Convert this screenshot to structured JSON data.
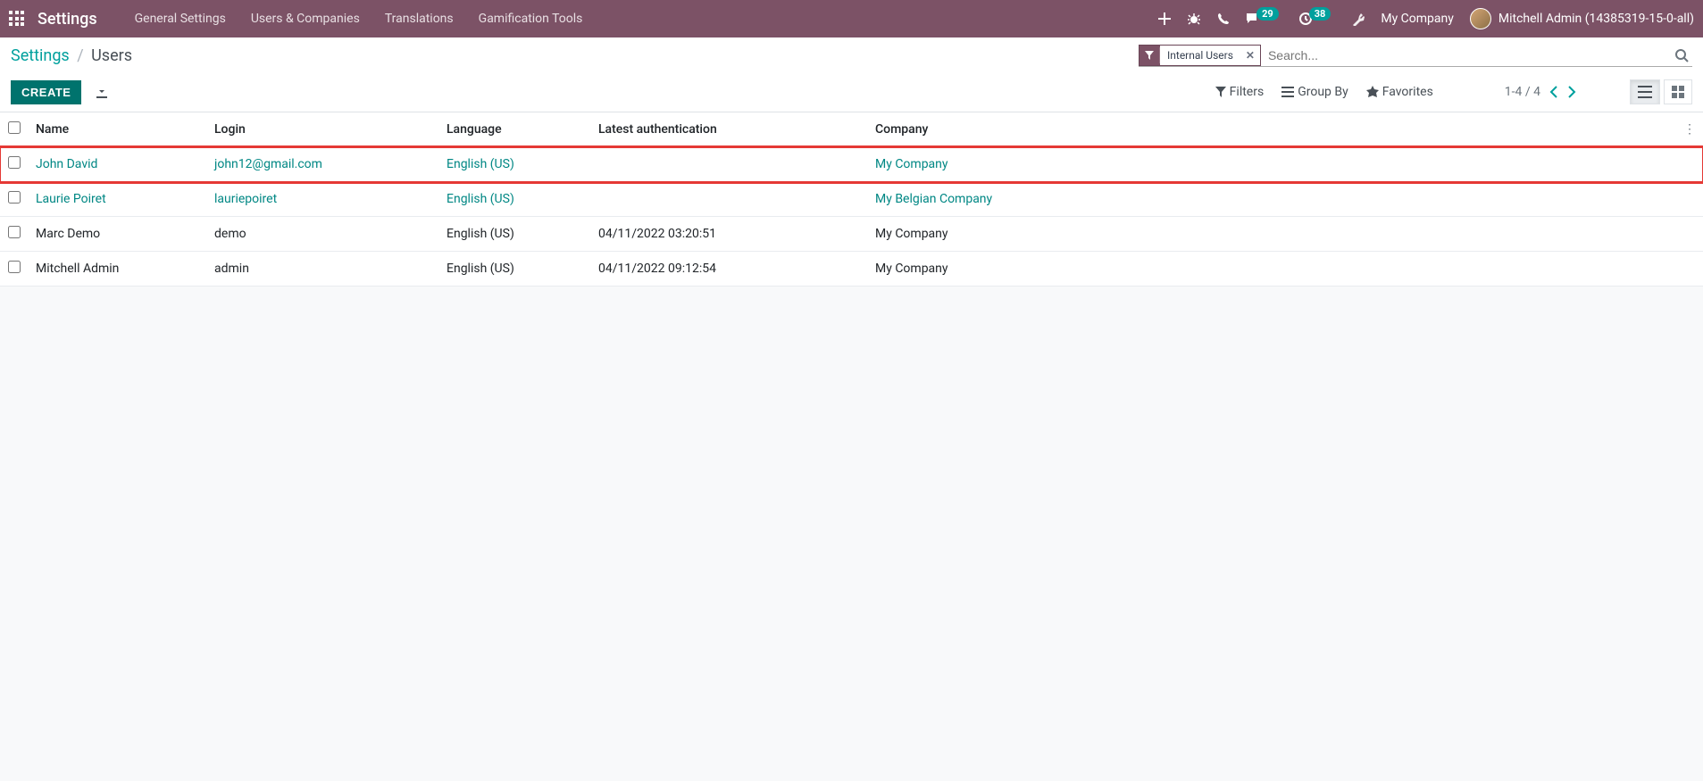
{
  "header": {
    "app_name": "Settings",
    "menu": [
      "General Settings",
      "Users & Companies",
      "Translations",
      "Gamification Tools"
    ],
    "badge1": "29",
    "badge2": "38",
    "company": "My Company",
    "user": "Mitchell Admin (14385319-15-0-all)"
  },
  "breadcrumb": {
    "root": "Settings",
    "current": "Users"
  },
  "search": {
    "filter_label": "Internal Users",
    "placeholder": "Search..."
  },
  "toolbar": {
    "create": "CREATE",
    "filters": "Filters",
    "group_by": "Group By",
    "favorites": "Favorites",
    "pager": "1-4 / 4"
  },
  "table": {
    "headers": {
      "name": "Name",
      "login": "Login",
      "language": "Language",
      "latest_auth": "Latest authentication",
      "company": "Company"
    },
    "rows": [
      {
        "name": "John David",
        "login": "john12@gmail.com",
        "language": "English (US)",
        "latest_auth": "",
        "company": "My Company",
        "linked": true,
        "highlighted": true
      },
      {
        "name": "Laurie Poiret",
        "login": "lauriepoiret",
        "language": "English (US)",
        "latest_auth": "",
        "company": "My Belgian Company",
        "linked": true,
        "highlighted": false
      },
      {
        "name": "Marc Demo",
        "login": "demo",
        "language": "English (US)",
        "latest_auth": "04/11/2022 03:20:51",
        "company": "My Company",
        "linked": false,
        "highlighted": false
      },
      {
        "name": "Mitchell Admin",
        "login": "admin",
        "language": "English (US)",
        "latest_auth": "04/11/2022 09:12:54",
        "company": "My Company",
        "linked": false,
        "highlighted": false
      }
    ]
  }
}
